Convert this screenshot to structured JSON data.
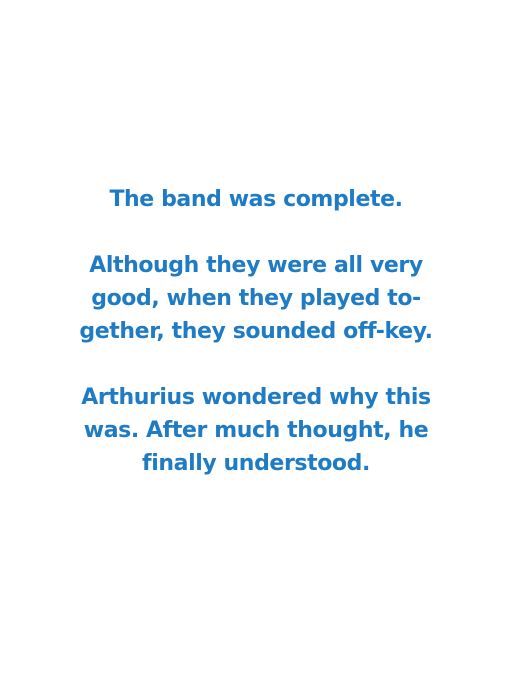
{
  "text_color": "#1f7cc4",
  "background_color": "#ffffff",
  "paragraphs": [
    {
      "lines": [
        "The band was complete."
      ]
    },
    {
      "lines": [
        "Although they were all very",
        "good, when they played to-",
        "gether, they sounded off-key."
      ]
    },
    {
      "lines": [
        "Arthurius wondered why this",
        "was. After much thought, he",
        "finally understood."
      ]
    }
  ]
}
